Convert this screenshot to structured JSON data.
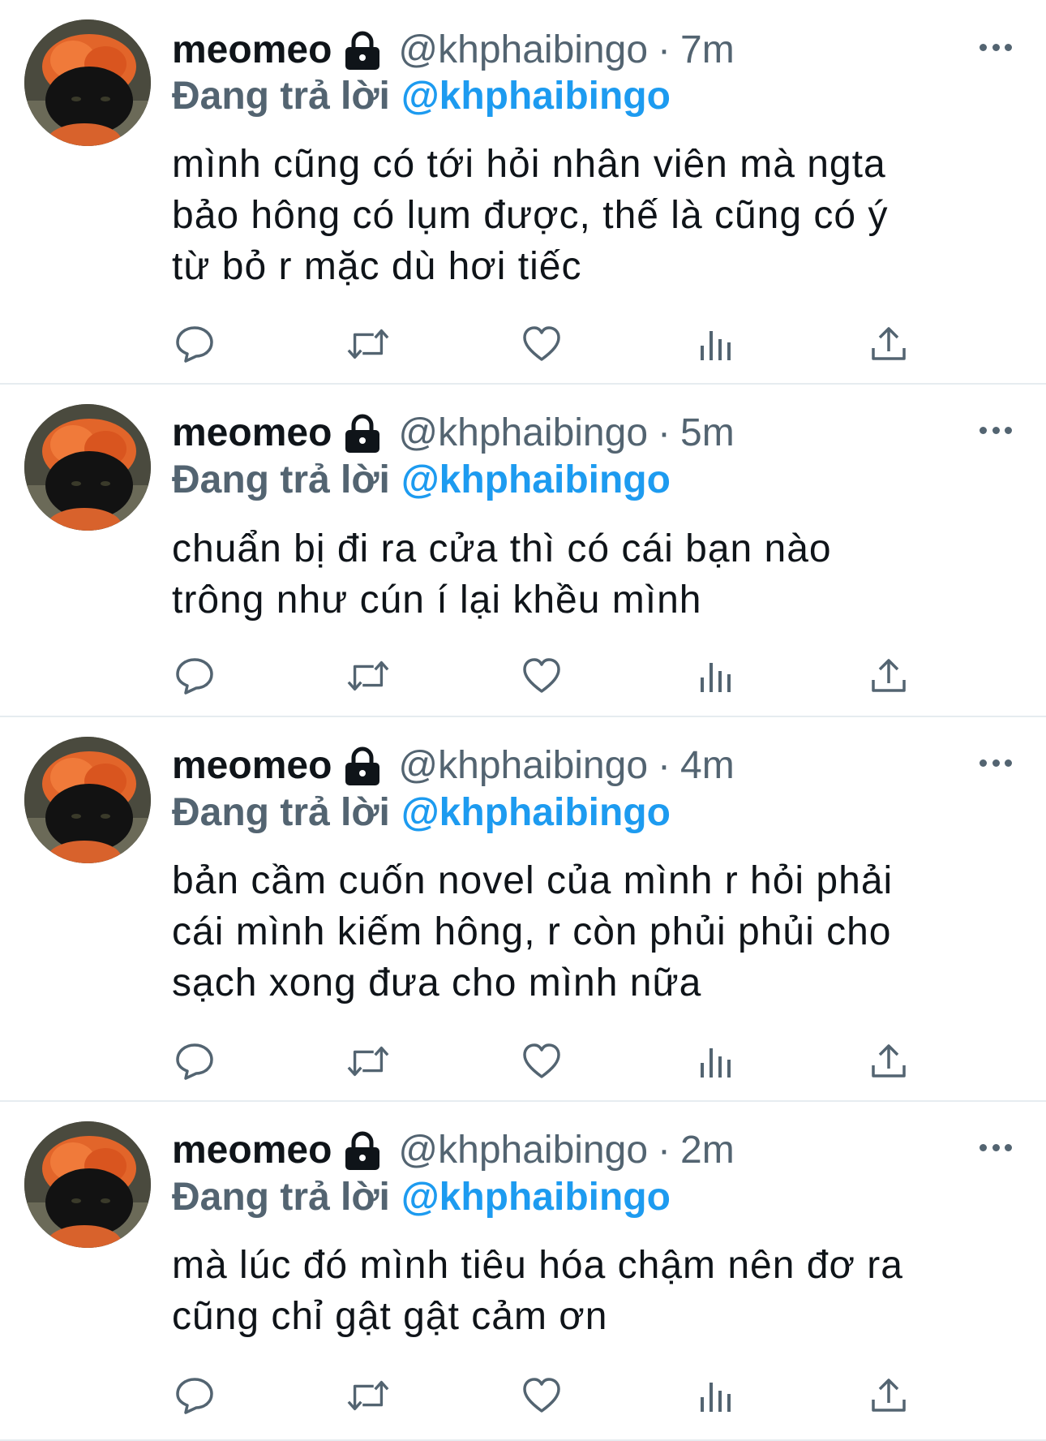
{
  "colors": {
    "text": "#0f1419",
    "secondary": "#536471",
    "accent": "#1d9bf0",
    "divider": "#e6ecf0"
  },
  "icons": {
    "lock": "lock-icon",
    "more": "more-icon",
    "reply": "reply-icon",
    "retweet": "retweet-icon",
    "like": "heart-icon",
    "views": "views-icon",
    "share": "share-icon"
  },
  "tweets": [
    {
      "display_name": "meomeo",
      "handle": "@khphaibingo",
      "separator": "·",
      "time": "7m",
      "reply_label": "Đang trả lời",
      "reply_to": "@khphaibingo",
      "text_lines": [
        "mình cũng có tới hỏi nhân viên mà ngta",
        "bảo hông có lụm được, thế là cũng có ý",
        "từ bỏ r mặc dù hơi tiếc"
      ]
    },
    {
      "display_name": "meomeo",
      "handle": "@khphaibingo",
      "separator": "·",
      "time": "5m",
      "reply_label": "Đang trả lời",
      "reply_to": "@khphaibingo",
      "text_lines": [
        "chuẩn bị đi ra cửa thì có cái bạn nào",
        "trông như cún í lại khều mình"
      ]
    },
    {
      "display_name": "meomeo",
      "handle": "@khphaibingo",
      "separator": "·",
      "time": "4m",
      "reply_label": "Đang trả lời",
      "reply_to": "@khphaibingo",
      "text_lines": [
        "bản cầm cuốn novel của mình r hỏi phải",
        "cái mình kiếm hông, r còn phủi phủi cho",
        "sạch xong đưa cho mình nữa"
      ]
    },
    {
      "display_name": "meomeo",
      "handle": "@khphaibingo",
      "separator": "·",
      "time": "2m",
      "reply_label": "Đang trả lời",
      "reply_to": "@khphaibingo",
      "text_lines": [
        "mà lúc đó mình tiêu hóa chậm nên đơ ra",
        "cũng chỉ gật gật cảm ơn"
      ]
    }
  ]
}
